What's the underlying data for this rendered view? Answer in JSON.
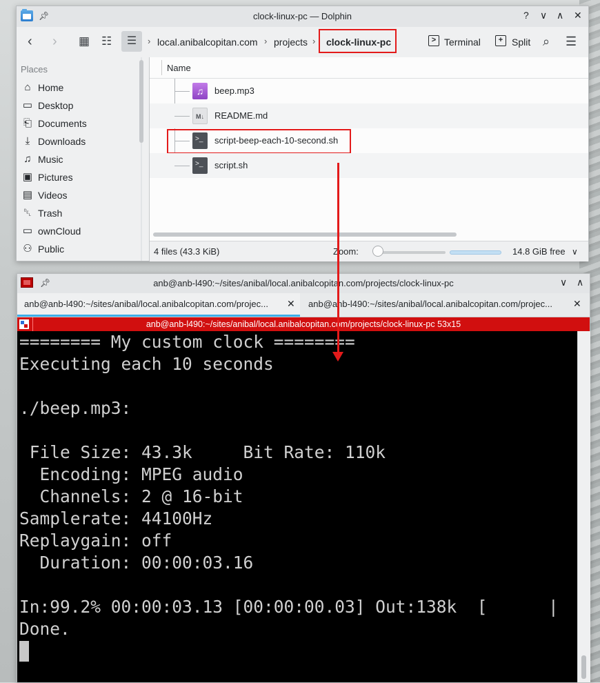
{
  "dolphin": {
    "title": "clock-linux-pc — Dolphin",
    "breadcrumb": [
      "local.anibalcopitan.com",
      "projects",
      "clock-linux-pc"
    ],
    "toolbar": {
      "terminal_label": "Terminal",
      "split_label": "Split"
    },
    "places": {
      "title": "Places",
      "items": [
        {
          "label": "Home",
          "icon": "home-icon"
        },
        {
          "label": "Desktop",
          "icon": "desktop-icon"
        },
        {
          "label": "Documents",
          "icon": "documents-icon"
        },
        {
          "label": "Downloads",
          "icon": "downloads-icon"
        },
        {
          "label": "Music",
          "icon": "music-icon"
        },
        {
          "label": "Pictures",
          "icon": "pictures-icon"
        },
        {
          "label": "Videos",
          "icon": "videos-icon"
        },
        {
          "label": "Trash",
          "icon": "trash-icon"
        },
        {
          "label": "ownCloud",
          "icon": "folder-icon"
        },
        {
          "label": "Public",
          "icon": "public-icon"
        }
      ]
    },
    "column_header": "Name",
    "files": [
      {
        "name": "beep.mp3",
        "type": "audio"
      },
      {
        "name": "README.md",
        "type": "markdown"
      },
      {
        "name": "script-beep-each-10-second.sh",
        "type": "shell"
      },
      {
        "name": "script.sh",
        "type": "shell"
      }
    ],
    "status": {
      "file_count": "4 files (43.3 KiB)",
      "zoom_label": "Zoom:",
      "free_space": "14.8 GiB free"
    }
  },
  "konsole": {
    "title": "anb@anb-l490:~/sites/anibal/local.anibalcopitan.com/projects/clock-linux-pc",
    "tabs": [
      {
        "label": "anb@anb-l490:~/sites/anibal/local.anibalcopitan.com/projec...",
        "active": true
      },
      {
        "label": "anb@anb-l490:~/sites/anibal/local.anibalcopitan.com/projec...",
        "active": false
      }
    ],
    "header": "anb@anb-l490:~/sites/anibal/local.anibalcopitan.com/projects/clock-linux-pc 53x15",
    "lines": [
      "======== My custom clock ========",
      "Executing each 10 seconds",
      "",
      "./beep.mp3:",
      "",
      " File Size: 43.3k     Bit Rate: 110k",
      "  Encoding: MPEG audio",
      "  Channels: 2 @ 16-bit",
      "Samplerate: 44100Hz",
      "Replaygain: off",
      "  Duration: 00:00:03.16",
      "",
      "In:99.2% 00:00:03.13 [00:00:00.03] Out:138k  [      |",
      "Done."
    ]
  },
  "colors": {
    "highlight_red": "#e31a1a",
    "konsole_header": "#d10f0f",
    "accent": "#3daee9"
  }
}
